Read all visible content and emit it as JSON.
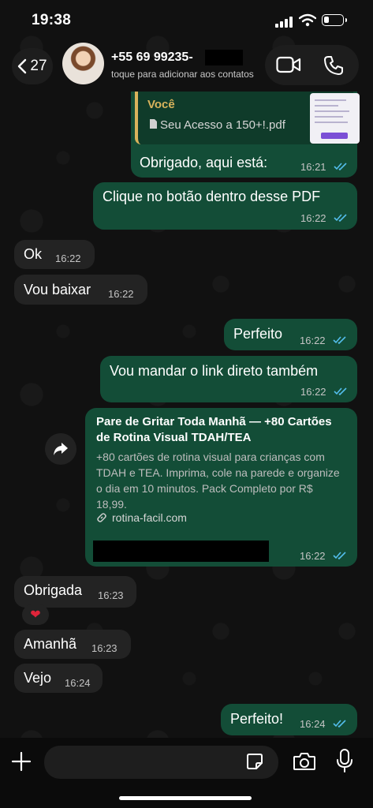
{
  "status_bar": {
    "time": "19:38"
  },
  "header": {
    "back_count": "27",
    "contact_name": "+55 69 99235-",
    "contact_subtitle": "toque para adicionar aos contatos"
  },
  "messages": [
    {
      "dir": "out",
      "quote_author": "Você",
      "quote_file": "Seu Acesso a 150+!.pdf",
      "text": "Obrigado, aqui está:",
      "time": "16:21"
    },
    {
      "dir": "out",
      "text": "Clique no botão dentro desse PDF",
      "time": "16:22"
    },
    {
      "dir": "in",
      "text": "Ok",
      "time": "16:22"
    },
    {
      "dir": "in",
      "text": "Vou baixar",
      "time": "16:22"
    },
    {
      "dir": "out",
      "text": "Perfeito",
      "time": "16:22"
    },
    {
      "dir": "out",
      "text": "Vou mandar o link direto também",
      "time": "16:22"
    },
    {
      "dir": "out",
      "link_title": "Pare de Gritar Toda Manhã — +80 Cartões de Rotina Visual TDAH/TEA",
      "link_description": "+80 cartões de rotina visual para crianças com TDAH e TEA. Imprima, cole na parede e organize o dia em 10 minutos. Pack Completo por R$ 18,99.",
      "link_domain": "rotina-facil.com",
      "time": "16:22"
    },
    {
      "dir": "in",
      "text": "Obrigada",
      "time": "16:23",
      "reaction": "❤"
    },
    {
      "dir": "in",
      "text": "Amanhã",
      "time": "16:23"
    },
    {
      "dir": "in",
      "text": "Vejo",
      "time": "16:24"
    },
    {
      "dir": "out",
      "text": "Perfeito!",
      "time": "16:24"
    }
  ],
  "composer": {
    "placeholder": ""
  },
  "colors": {
    "outgoing_bubble": "#134d37",
    "incoming_bubble": "#232323",
    "read_ticks": "#53bdeb",
    "quote_accent": "#d9b35c"
  }
}
